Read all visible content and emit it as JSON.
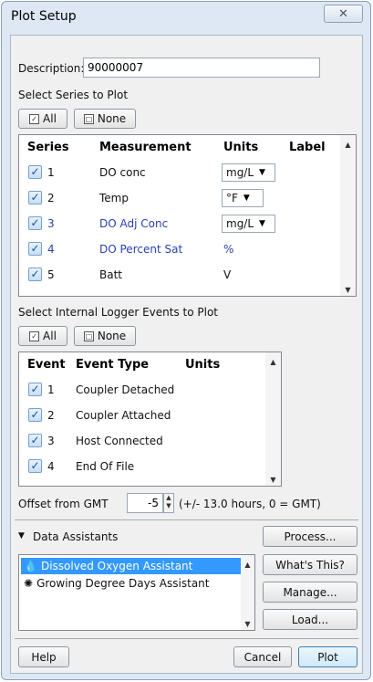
{
  "window": {
    "title": "Plot Setup",
    "close_glyph": "✕"
  },
  "description": {
    "label": "Description:",
    "value": "90000007"
  },
  "series_section": {
    "label": "Select Series to Plot",
    "all_button": "All",
    "none_button": "None",
    "headers": {
      "series": "Series",
      "measurement": "Measurement",
      "units": "Units",
      "label": "Label"
    },
    "rows": [
      {
        "num": "1",
        "checked": true,
        "measurement": "DO conc",
        "units": "mg/L",
        "dropdown": true,
        "blue": false
      },
      {
        "num": "2",
        "checked": true,
        "measurement": "Temp",
        "units": "°F",
        "dropdown": true,
        "blue": false
      },
      {
        "num": "3",
        "checked": true,
        "measurement": "DO Adj Conc",
        "units": "mg/L",
        "dropdown": true,
        "blue": true
      },
      {
        "num": "4",
        "checked": true,
        "measurement": "DO Percent Sat",
        "units": "%",
        "dropdown": false,
        "blue": true
      },
      {
        "num": "5",
        "checked": true,
        "measurement": "Batt",
        "units": "V",
        "dropdown": false,
        "blue": false
      }
    ]
  },
  "events_section": {
    "label": "Select Internal Logger Events to Plot",
    "all_button": "All",
    "none_button": "None",
    "headers": {
      "event": "Event",
      "event_type": "Event Type",
      "units": "Units"
    },
    "rows": [
      {
        "num": "1",
        "checked": true,
        "type": "Coupler Detached"
      },
      {
        "num": "2",
        "checked": true,
        "type": "Coupler Attached"
      },
      {
        "num": "3",
        "checked": true,
        "type": "Host Connected"
      },
      {
        "num": "4",
        "checked": true,
        "type": "End Of File"
      }
    ]
  },
  "offset": {
    "label": "Offset from GMT",
    "value": "-5",
    "hint": "(+/- 13.0 hours, 0 = GMT)"
  },
  "assistants": {
    "label": "Data Assistants",
    "items": [
      {
        "name": "Dissolved Oxygen Assistant",
        "selected": true,
        "icon": "water-drop-icon"
      },
      {
        "name": "Growing Degree Days Assistant",
        "selected": false,
        "icon": "sun-icon"
      }
    ],
    "buttons": {
      "process": "Process...",
      "whats_this": "What's This?",
      "manage": "Manage...",
      "load": "Load..."
    }
  },
  "footer": {
    "help": "Help",
    "cancel": "Cancel",
    "plot": "Plot"
  },
  "colors": {
    "accent": "#3399ff",
    "blue_text": "#2a3fb0",
    "panel": "#f0f0f0",
    "frame": "#dde8f4"
  }
}
